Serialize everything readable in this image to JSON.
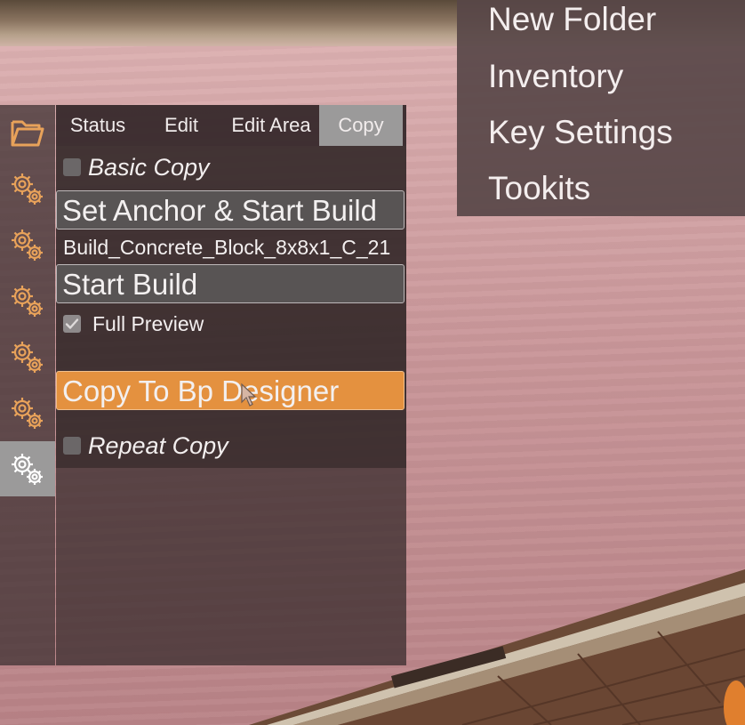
{
  "menu": {
    "items": [
      {
        "label": "New Folder"
      },
      {
        "label": "Inventory"
      },
      {
        "label": "Key Settings"
      },
      {
        "label": "Tookits"
      }
    ]
  },
  "sidebar": {
    "icons": [
      {
        "name": "folder-icon"
      },
      {
        "name": "gear-icon"
      },
      {
        "name": "gear-icon"
      },
      {
        "name": "gear-icon"
      },
      {
        "name": "gear-icon"
      },
      {
        "name": "gear-icon"
      },
      {
        "name": "gear-icon"
      }
    ],
    "active_index": 6,
    "icon_color": "#e8a25a"
  },
  "tabs": [
    {
      "label": "Status"
    },
    {
      "label": "Edit"
    },
    {
      "label": "Edit Area"
    },
    {
      "label": "Copy"
    }
  ],
  "active_tab": "Copy",
  "copy_panel": {
    "basic_copy": {
      "label": "Basic Copy",
      "checked": false
    },
    "set_anchor_button": "Set Anchor & Start Build",
    "blueprint_name": "Build_Concrete_Block_8x8x1_C_21",
    "start_build_button": "Start Build",
    "full_preview": {
      "label": "Full Preview",
      "checked": true
    },
    "copy_to_bp_button": "Copy To Bp Designer",
    "repeat_copy": {
      "label": "Repeat Copy",
      "checked": false
    }
  },
  "colors": {
    "accent_orange": "#e4913f",
    "active_tab_gray": "#9b9a9a"
  }
}
